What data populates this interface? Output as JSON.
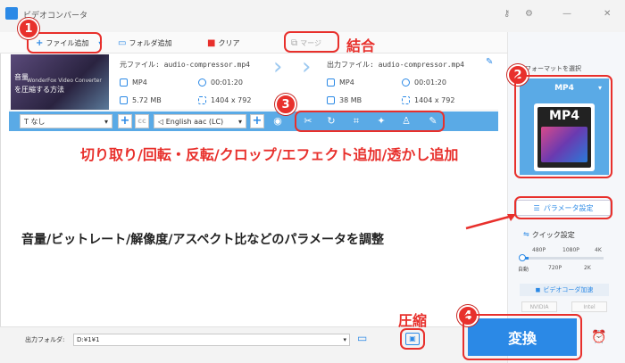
{
  "app": {
    "title": "ビデオコンバータ"
  },
  "toolbar": {
    "add_file": "ファイル追加",
    "add_folder": "フォルダ追加",
    "clear": "クリア",
    "merge": "マージ"
  },
  "file": {
    "source_label": "元ファイル: audio-compressor.mp4",
    "output_label": "出力ファイル: audio-compressor.mp4",
    "src_format": "MP4",
    "src_duration": "00:01:20",
    "src_size": "5.72 MB",
    "src_resolution": "1404 x 792",
    "out_format": "MP4",
    "out_duration": "00:01:20",
    "out_size": "38 MB",
    "out_resolution": "1404 x 792",
    "thumb_text1": "音量",
    "thumb_text2": "を圧縮する方法",
    "thumb_text3": "WonderFox Video Converter"
  },
  "bar": {
    "subtitle": "なし",
    "audio": "English aac (LC)"
  },
  "sidebar": {
    "format_select": "フォーマットを選択",
    "format": "MP4",
    "format_icon_text": "MP4",
    "param_button": "パラメータ設定",
    "quick_setting": "クイック設定",
    "q_480": "480P",
    "q_1080": "1080P",
    "q_4k": "4K",
    "q_auto": "自動",
    "q_720": "720P",
    "q_2k": "2K",
    "gpu": "ビデオコーダ加速",
    "nvidia": "NVIDIA",
    "intel": "Intel"
  },
  "bottom": {
    "output_folder_label": "出力フォルダ:",
    "output_folder_path": "D:¥1¥1",
    "convert": "変換"
  },
  "annotations": {
    "n1": "1",
    "n2": "2",
    "n3": "3",
    "n4": "4",
    "merge_note": "結合",
    "edit_note": "切り取り/回転・反転/クロップ/エフェクト追加/透かし追加",
    "param_note": "音量/ビットレート/解像度/アスペクト比などのパラメータを調整",
    "compress_note": "圧縮"
  },
  "colors": {
    "accent": "#2b89e6",
    "annotation_red": "#e8302c",
    "bar_blue": "#5aaae6"
  }
}
